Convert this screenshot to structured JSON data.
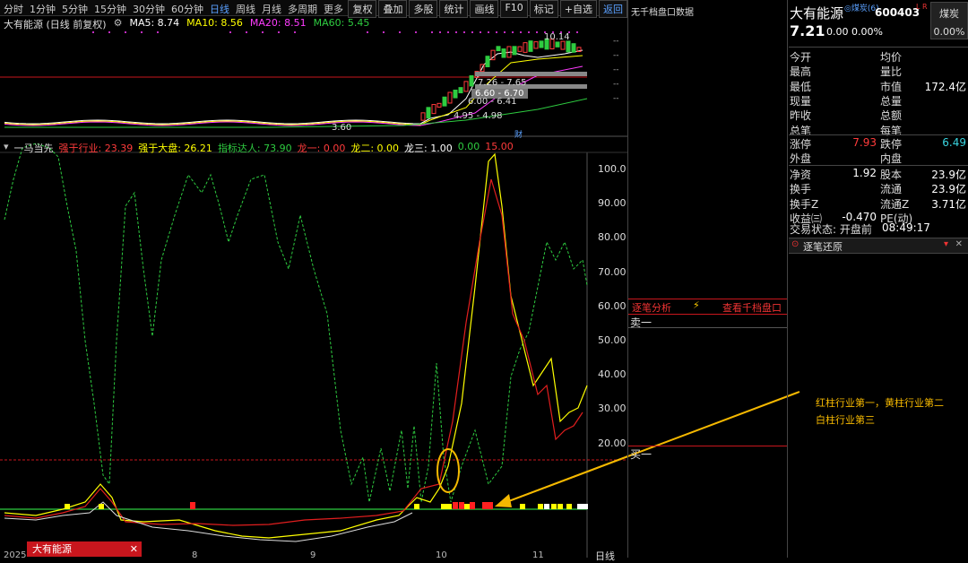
{
  "toolbar": {
    "periods": [
      "分时",
      "1分钟",
      "5分钟",
      "15分钟",
      "30分钟",
      "60分钟",
      "日线",
      "周线",
      "月线",
      "多周期",
      "更多"
    ],
    "active_period": "日线",
    "buttons": [
      "复权",
      "叠加",
      "多股",
      "统计",
      "画线",
      "F10",
      "标记",
      "+自选",
      "返回"
    ]
  },
  "kline": {
    "title": "大有能源 (日线 前复权)",
    "ma": [
      {
        "label": "MA5: 8.74",
        "color": "#ffffff"
      },
      {
        "label": "MA10: 8.56",
        "color": "#ffff00"
      },
      {
        "label": "MA20: 8.51",
        "color": "#ff3cff"
      },
      {
        "label": "MA60: 5.45",
        "color": "#2ecc40"
      }
    ],
    "high_label": "10.14",
    "low_label": "3.60",
    "cost_labels": [
      "7.26 - 7.65",
      "6.60 - 6.70",
      "6.00 - 6.41",
      "4.95 - 4.98"
    ],
    "fin_mark": "财",
    "right_ticks": [
      "--",
      "--",
      "--",
      "--",
      "--"
    ]
  },
  "indicator": {
    "name": "一马当先",
    "items": [
      {
        "label": "强于行业: 23.39",
        "color": "#ff3b3b"
      },
      {
        "label": "强于大盘: 26.21",
        "color": "#ffff00"
      },
      {
        "label": "指标达人: 73.90",
        "color": "#2ecc40"
      },
      {
        "label": "龙一: 0.00",
        "color": "#ff3b3b"
      },
      {
        "label": "龙二: 0.00",
        "color": "#ffff00"
      },
      {
        "label": "龙三: 1.00",
        "color": "#ffffff"
      },
      {
        "label": "0.00",
        "color": "#2ecc40"
      },
      {
        "label": "15.00",
        "color": "#ff3b3b"
      }
    ],
    "yaxis": [
      "100.0",
      "90.00",
      "80.00",
      "70.00",
      "60.00",
      "50.00",
      "40.00",
      "30.00",
      "20.00"
    ],
    "period_label": "日线",
    "bottom_dates": [
      "2025",
      "8",
      "9",
      "10",
      "11"
    ],
    "tab_label": "大有能源"
  },
  "annotation": {
    "lines": [
      "红柱行业第一，黄柱行业第二",
      "白柱行业第三"
    ]
  },
  "orderbook": {
    "title": "无千档盘口数据",
    "tabs": [
      "逐笔分析",
      "查看千档盘口"
    ],
    "sell1": "卖一",
    "buy1": "买一"
  },
  "quote": {
    "name": "大有能源",
    "tag": "◎煤炭(6)",
    "code": "600403",
    "flags": "L R",
    "sector": "煤炭",
    "sector_change": "0.00%",
    "price": "7.21",
    "change": "0.00",
    "change_pct": "0.00%",
    "rows": [
      {
        "l1": "今开",
        "v1": "",
        "l2": "均价",
        "v2": ""
      },
      {
        "l1": "最高",
        "v1": "",
        "l2": "量比",
        "v2": ""
      },
      {
        "l1": "最低",
        "v1": "",
        "l2": "市值",
        "v2": "172.4亿"
      },
      {
        "l1": "现量",
        "v1": "",
        "l2": "总量",
        "v2": ""
      },
      {
        "l1": "昨收",
        "v1": "",
        "l2": "总额",
        "v2": ""
      },
      {
        "l1": "总笔",
        "v1": "",
        "l2": "每笔",
        "v2": ""
      }
    ],
    "rows2": [
      {
        "l1": "涨停",
        "v1": "7.93",
        "l2": "跌停",
        "v2": "6.49"
      },
      {
        "l1": "外盘",
        "v1": "",
        "l2": "内盘",
        "v2": ""
      }
    ],
    "rows3": [
      {
        "l1": "净资",
        "v1": "1.92",
        "l2": "股本",
        "v2": "23.9亿"
      },
      {
        "l1": "换手",
        "v1": "",
        "l2": "流通",
        "v2": "23.9亿"
      },
      {
        "l1": "换手Z",
        "v1": "",
        "l2": "流通Z",
        "v2": "3.71亿"
      },
      {
        "l1": "收益㈢",
        "v1": "-0.470",
        "l2": "PE(动)",
        "v2": ""
      }
    ],
    "status_label": "交易状态: 开盘前",
    "status_time": "08:49:17",
    "tick_title": "逐笔还原"
  },
  "colors": {
    "up": "#ff3b3b",
    "down": "#2ecc40",
    "accent": "#5aa0ff"
  }
}
